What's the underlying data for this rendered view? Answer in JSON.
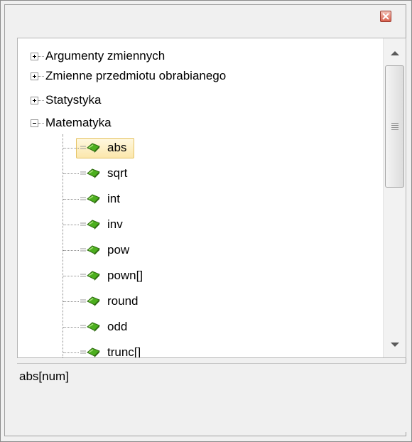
{
  "window": {
    "close_icon": "close-icon",
    "accent": "#d9604d"
  },
  "tree": {
    "groups": [
      {
        "label": "Argumenty zmiennych",
        "state": "collapsed"
      },
      {
        "label": "Zmienne przedmiotu obrabianego",
        "state": "collapsed"
      },
      {
        "label": "Statystyka",
        "state": "collapsed"
      },
      {
        "label": "Matematyka",
        "state": "expanded"
      }
    ],
    "functions": [
      "abs",
      "sqrt",
      "int",
      "inv",
      "pow",
      "pown[]",
      "round",
      "odd",
      "trunc[]"
    ],
    "selected": "abs",
    "function_icon": "function-icon",
    "selection_color": "#fbe7ac"
  },
  "description": {
    "text": "abs[num]"
  },
  "scrollbar": {
    "up_icon": "scroll-up-arrow-icon",
    "down_icon": "scroll-down-arrow-icon"
  }
}
